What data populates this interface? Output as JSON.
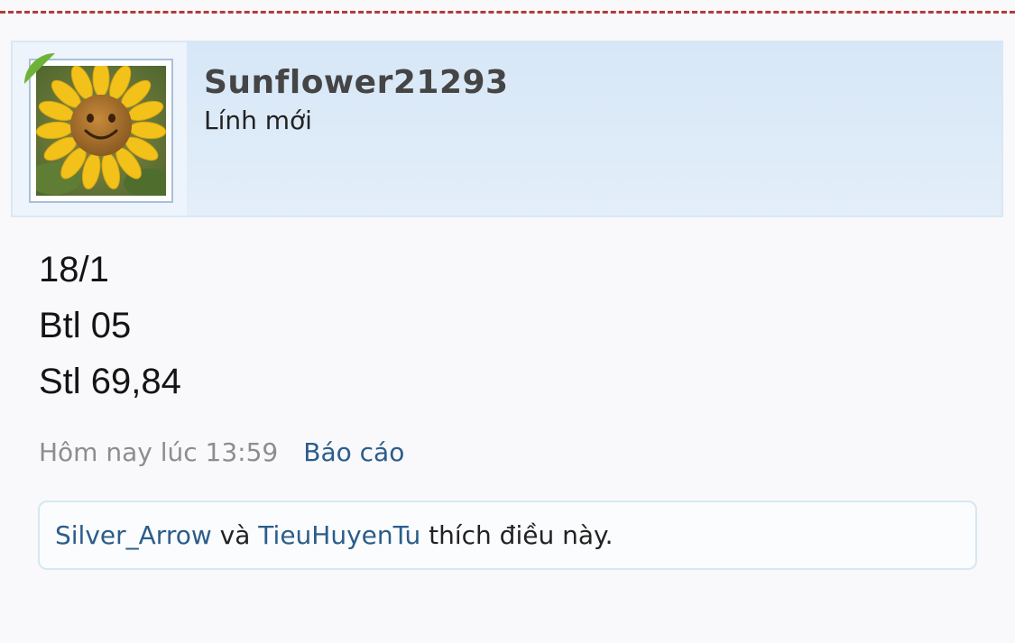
{
  "post": {
    "author": {
      "username": "Sunflower21293",
      "title": "Lính mới",
      "avatar": "sunflower-avatar"
    },
    "body_lines": [
      "18/1",
      "Btl 05",
      "Stl 69,84"
    ],
    "timestamp": "Hôm nay lúc 13:59",
    "report_label": "Báo cáo",
    "likes": {
      "users": [
        "Silver_Arrow",
        "TieuHuyenTu"
      ],
      "connector": "và",
      "suffix": "thích điều này."
    }
  },
  "colors": {
    "link": "#2b5d8a",
    "header_bg": "#d7e7f7",
    "divider": "#b33a3a",
    "online": "#6fb23a"
  }
}
